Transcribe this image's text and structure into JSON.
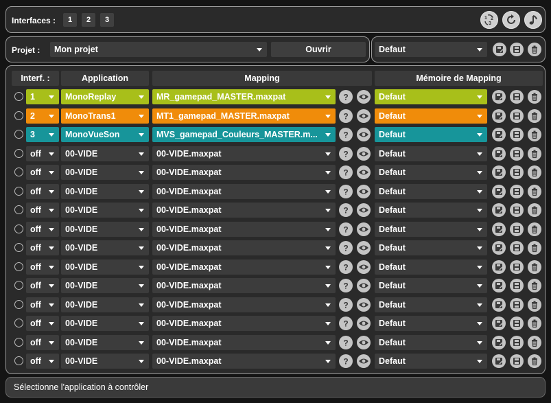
{
  "interfaces": {
    "label": "Interfaces :",
    "buttons": [
      "1",
      "2",
      "3"
    ]
  },
  "project": {
    "label": "Projet :",
    "value": "Mon projet",
    "open_button": "Ouvrir",
    "memory_value": "Defaut"
  },
  "table": {
    "headers": {
      "interface": "Interf. :",
      "application": "Application",
      "mapping": "Mapping",
      "memory": "Mémoire de Mapping"
    },
    "rows": [
      {
        "interface": "1",
        "application": "MonoReplay",
        "mapping": "MR_gamepad_MASTER.maxpat",
        "memory": "Defaut",
        "color": "#a8bf1a"
      },
      {
        "interface": "2",
        "application": "MonoTrans1",
        "mapping": "MT1_gamepad_MASTER.maxpat",
        "memory": "Defaut",
        "color": "#f08c0a"
      },
      {
        "interface": "3",
        "application": "MonoVueSon",
        "mapping": "MVS_gamepad_Couleurs_MASTER.m...",
        "memory": "Defaut",
        "color": "#17959a"
      },
      {
        "interface": "off",
        "application": "00-VIDE",
        "mapping": "00-VIDE.maxpat",
        "memory": "Defaut",
        "color": ""
      },
      {
        "interface": "off",
        "application": "00-VIDE",
        "mapping": "00-VIDE.maxpat",
        "memory": "Defaut",
        "color": ""
      },
      {
        "interface": "off",
        "application": "00-VIDE",
        "mapping": "00-VIDE.maxpat",
        "memory": "Defaut",
        "color": ""
      },
      {
        "interface": "off",
        "application": "00-VIDE",
        "mapping": "00-VIDE.maxpat",
        "memory": "Defaut",
        "color": ""
      },
      {
        "interface": "off",
        "application": "00-VIDE",
        "mapping": "00-VIDE.maxpat",
        "memory": "Defaut",
        "color": ""
      },
      {
        "interface": "off",
        "application": "00-VIDE",
        "mapping": "00-VIDE.maxpat",
        "memory": "Defaut",
        "color": ""
      },
      {
        "interface": "off",
        "application": "00-VIDE",
        "mapping": "00-VIDE.maxpat",
        "memory": "Defaut",
        "color": ""
      },
      {
        "interface": "off",
        "application": "00-VIDE",
        "mapping": "00-VIDE.maxpat",
        "memory": "Defaut",
        "color": ""
      },
      {
        "interface": "off",
        "application": "00-VIDE",
        "mapping": "00-VIDE.maxpat",
        "memory": "Defaut",
        "color": ""
      },
      {
        "interface": "off",
        "application": "00-VIDE",
        "mapping": "00-VIDE.maxpat",
        "memory": "Defaut",
        "color": ""
      },
      {
        "interface": "off",
        "application": "00-VIDE",
        "mapping": "00-VIDE.maxpat",
        "memory": "Defaut",
        "color": ""
      },
      {
        "interface": "off",
        "application": "00-VIDE",
        "mapping": "00-VIDE.maxpat",
        "memory": "Defaut",
        "color": ""
      }
    ]
  },
  "status": "Sélectionne l'application à contrôler",
  "icons": {
    "top_right": [
      "numbers-cycle-icon",
      "refresh-icon",
      "music-note-icon"
    ],
    "row_actions": [
      "help-icon",
      "eye-icon"
    ],
    "memory_actions": [
      "save-as-icon",
      "save-icon",
      "trash-icon"
    ]
  }
}
